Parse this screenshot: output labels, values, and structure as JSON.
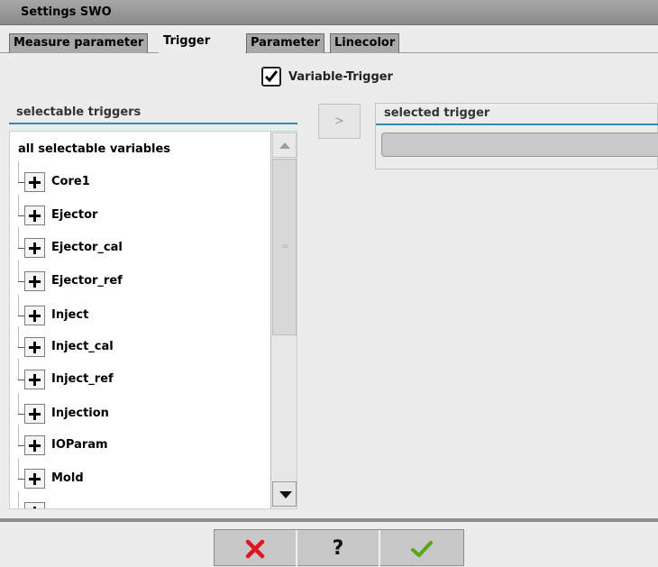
{
  "window": {
    "title": "Settings SWO"
  },
  "tabs": [
    {
      "label": "Measure parameter",
      "active": false
    },
    {
      "label": "Trigger",
      "active": true
    },
    {
      "label": "Parameter",
      "active": false
    },
    {
      "label": "Linecolor",
      "active": false
    }
  ],
  "variable_trigger": {
    "label": "Variable-Trigger",
    "checked": true
  },
  "selectable_panel": {
    "title": "selectable triggers",
    "root_label": "all selectable variables",
    "items": [
      "Core1",
      "Ejector",
      "Ejector_cal",
      "Ejector_ref",
      "Inject",
      "Inject_cal",
      "Inject_ref",
      "Injection",
      "IOParam",
      "Mold"
    ]
  },
  "move_button": {
    "label": ">"
  },
  "selected_panel": {
    "title": "selected trigger"
  },
  "scrollbar": {
    "thumb_glyph": "="
  },
  "footer": {
    "cancel_icon": "red-x-icon",
    "help_label": "?",
    "ok_icon": "green-check-icon",
    "colors": {
      "cancel": "#e1141c",
      "ok": "#5aa514",
      "accent": "#2b8fae"
    }
  }
}
